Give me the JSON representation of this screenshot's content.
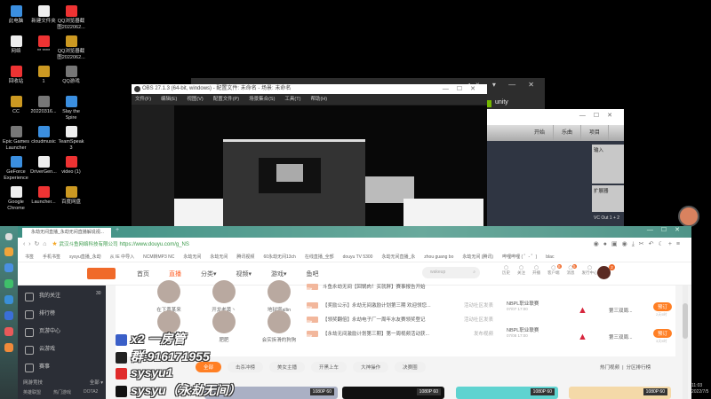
{
  "desktop": {
    "icons": [
      [
        "此电脑",
        "网络",
        "回收站",
        "CC",
        "Epic Games Launcher",
        "GeForce Experience",
        "Google Chrome"
      ],
      [
        "新建文件夹",
        "** ****",
        "1",
        "20220316...",
        "cloudmusic",
        "DriverGen...",
        "Launcher..."
      ],
      [
        "QQ浏览器截图2022062...",
        "QQ浏览器截图2022062...",
        "QQ游戏",
        "Slay the Spire",
        "TeamSpeak 3",
        "video (1)",
        "百度网盘"
      ]
    ]
  },
  "obs": {
    "title": "OBS 27.1.3 (64-bit, windows) - 配置文件: 未命名 - 场景: 未命名",
    "menu": [
      "文件(F)",
      "编辑(E)",
      "视图(V)",
      "配置文件(P)",
      "场景集合(S)",
      "工具(T)",
      "帮助(H)"
    ]
  },
  "daw": {
    "buttons": [
      "开始",
      "乐曲",
      "项目"
    ],
    "panel_input": "输入",
    "panel_ext": "扩展器",
    "output": "VC Out 1 + 2",
    "unity": "unity"
  },
  "browser": {
    "tab": "永劫无间直播_永劫无间直播解说视...",
    "site_owner": "武汉斗鱼网络科技有限公司",
    "url": "https://www.douyu.com/g_NS",
    "bookmarks": [
      "书签",
      "手机书签",
      "sysyu直播_永劫",
      "从 IE 中导入",
      "NCM转MP3 NC",
      "永劫无间",
      "永劫无间",
      "腾讯视频",
      "60永劫无间13ch",
      "在线直播_全部",
      "douyu TV 5300",
      "永劫无间直播_永",
      "zhou guang bo",
      "永劫无间 (腾讯)",
      "哔哩哔哩 ( ゜- ゜)",
      "blac"
    ],
    "nav": [
      "首页",
      "直播",
      "分类▾",
      "视频▾",
      "游戏▾",
      "鱼吧"
    ],
    "search_placeholder": "wakeup",
    "header_icons": [
      "历史",
      "关注",
      "开播",
      "客户端",
      "消息",
      "发行中心"
    ],
    "badges": {
      "client": "8",
      "msg": "5",
      "avatar": "2"
    }
  },
  "sidebar": {
    "items": [
      "我的关注",
      "排行榜",
      "页游中心",
      "云游戏",
      "赛事"
    ],
    "follow_count": "30",
    "section": "网游竞技",
    "section_more": "全部 ▾",
    "sub": [
      "英雄联盟",
      "热门游戏",
      "DOTA2"
    ]
  },
  "anchors": [
    "在下黄某来",
    "开龙老黄丶",
    "地狱塔allin",
    "",
    "肥肥",
    "会实拆滑的狗狗"
  ],
  "news": [
    {
      "tag": "活动",
      "text": "斗鱼永劫无间【回锅肉！买就胖】赛事报告开始",
      "src": ""
    },
    {
      "tag": "活动",
      "text": "【奖励公示】永劫无间激励计划第三期 欢迎领您...",
      "src": "活动社区发表"
    },
    {
      "tag": "活动",
      "text": "【领奖翻倍】永劫电子厂一周年水友赛领奖登记",
      "src": "活动社区发表"
    },
    {
      "tag": "活动",
      "text": "【永劫无间激励计划第三期】第一周视频活动获...",
      "src": "发布视频"
    }
  ],
  "matches": [
    {
      "name": "NBPL职业联赛",
      "time": "07/07 17:00",
      "team": "第三双周...",
      "btn": "预订",
      "sub": "2天5时"
    },
    {
      "name": "NBPL职业联赛",
      "time": "07/08 17:00",
      "team": "第三双周...",
      "btn": "预订",
      "sub": "3天5时"
    }
  ],
  "chips": [
    "全部",
    "击杀冲榜",
    "美女主播",
    "开黑上车",
    "大神操作",
    "决赛圈"
  ],
  "right_links": [
    "热门视频",
    "分区排行榜"
  ],
  "quality": "1080P 60",
  "overlay": {
    "line1": "x2 一房管",
    "line2": "群:916171955",
    "line3": "sysyu1",
    "line4": "sysyu（永劫无间）"
  },
  "clock": {
    "time": "11:03",
    "date": "2022/7/5"
  },
  "colors": {
    "accent": "#ff7f24",
    "teal": "#4f9488",
    "sidebar": "#2b2e36"
  }
}
